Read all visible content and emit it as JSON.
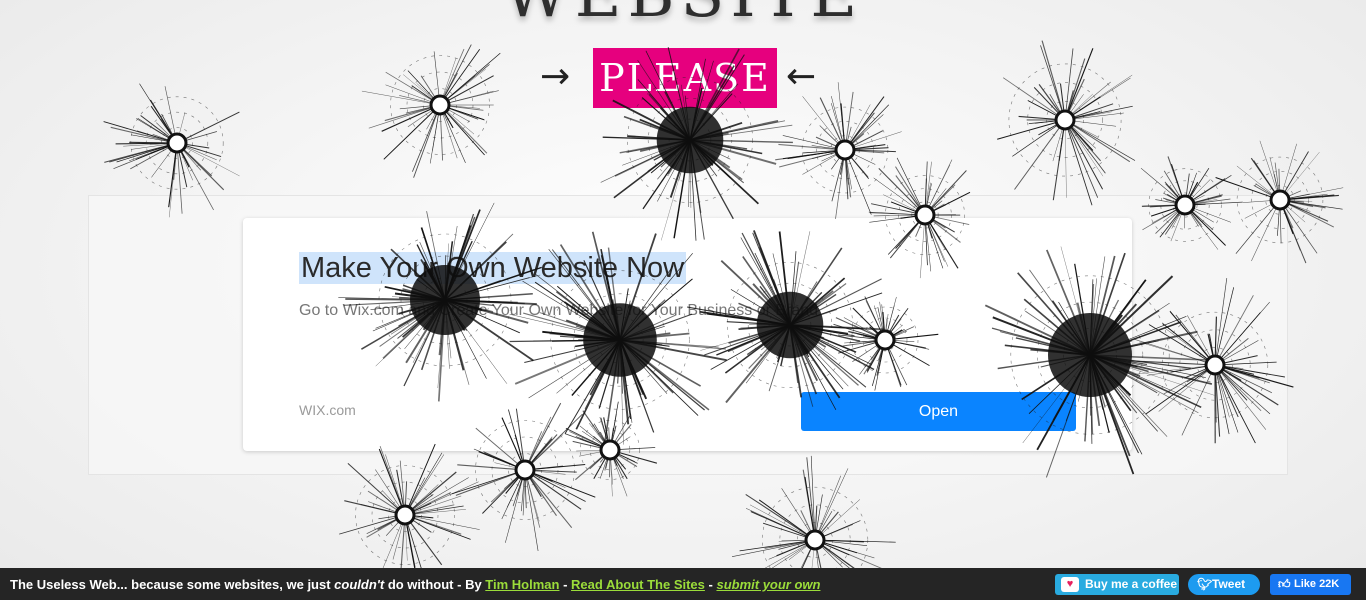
{
  "header": {
    "title": "WEBSITE",
    "tagline": "PLEASE",
    "arrow_left": "→",
    "arrow_right": "←"
  },
  "ad": {
    "title_hl": "Make Your Own Website Now",
    "description": "Go to Wix.com and Create Your Own Website for Your Business or Brand",
    "domain": "WIX.com",
    "open_label": "Open"
  },
  "footer": {
    "prefix": "The Useless Web... because some websites, we just ",
    "emph": "couldn't",
    "middle": " do without - By ",
    "author": "Tim Holman",
    "sep1": " - ",
    "about": "Read About The Sites",
    "sep2": " - ",
    "submit": "submit your own",
    "coffee_label": "Buy me a coffee",
    "tweet_label": "Tweet",
    "like_label": "Like 22K"
  },
  "icons": {
    "coffee": "coffee-cup-icon",
    "tweet": "twitter-bird-icon",
    "like": "thumbs-up-icon"
  },
  "colors": {
    "please_bg": "#e6007e",
    "open_button": "#0a84ff",
    "footer_bg": "#252525",
    "footer_link": "#9bdc3a",
    "coffee_btn": "#29abe0",
    "tweet_btn": "#1d9bf0",
    "like_btn": "#1877f2"
  }
}
